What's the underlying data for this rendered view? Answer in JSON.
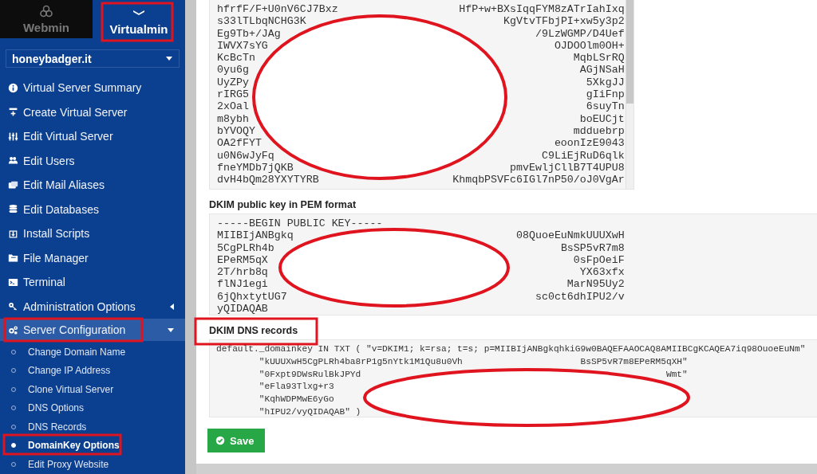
{
  "sidebar": {
    "tabs": [
      {
        "label": "Webmin",
        "selected": false
      },
      {
        "label": "Virtualmin",
        "selected": true
      }
    ],
    "domain_select": {
      "value": "honeybadger.it"
    },
    "menu": [
      {
        "kind": "link",
        "label": "Virtual Server Summary"
      },
      {
        "kind": "link",
        "label": "Create Virtual Server"
      },
      {
        "kind": "link",
        "label": "Edit Virtual Server"
      },
      {
        "kind": "link",
        "label": "Edit Users"
      },
      {
        "kind": "link",
        "label": "Edit Mail Aliases"
      },
      {
        "kind": "link",
        "label": "Edit Databases"
      },
      {
        "kind": "link",
        "label": "Install Scripts"
      },
      {
        "kind": "link",
        "label": "File Manager"
      },
      {
        "kind": "link",
        "label": "Terminal"
      },
      {
        "kind": "group",
        "label": "Administration Options",
        "expanded": false
      },
      {
        "kind": "group",
        "label": "Server Configuration",
        "expanded": true,
        "children": [
          {
            "label": "Change Domain Name",
            "selected": false
          },
          {
            "label": "Change IP Address",
            "selected": false
          },
          {
            "label": "Clone Virtual Server",
            "selected": false
          },
          {
            "label": "DNS Options",
            "selected": false
          },
          {
            "label": "DNS Records",
            "selected": false
          },
          {
            "label": "DomainKey Options",
            "selected": true
          },
          {
            "label": "Edit Proxy Website",
            "selected": false
          }
        ]
      }
    ]
  },
  "main": {
    "private_key": {
      "lines": [
        {
          "left": "hfrfF/F+U0nV6CJ7Bxz",
          "right": "HfP+w+BXsIqqFYM8zATrIahIxq"
        },
        {
          "left": "s33lTLbqNCHG3K",
          "right": "KgVtvTFbjPI+xw5y3p2"
        },
        {
          "left": "Eg9Tb+/JAg",
          "right": "/9LzWGMP/D4Uef"
        },
        {
          "left": "IWVX7sYG",
          "right": "OJDOOlm0OH+"
        },
        {
          "left": "KcBcTn",
          "right": "MqbLSrRQ"
        },
        {
          "left": "0yu6g",
          "right": "AGjNSaH"
        },
        {
          "left": "UyZPy",
          "right": "5XkgJJ"
        },
        {
          "left": "rIRG5",
          "right": "gIiFnp"
        },
        {
          "left": "2xOal",
          "right": "6suyTn"
        },
        {
          "left": "m8ybh",
          "right": "boEUCjt"
        },
        {
          "left": "bYVOQY",
          "right": "mdduebrp"
        },
        {
          "left": "OA2fFYT",
          "right": "eoonIzE9043"
        },
        {
          "left": "u0N6wJyFq",
          "right": "C9LiEjRuD6qlk"
        },
        {
          "left": "fneYMDb7jQKB",
          "right": "pmvEwljCllB7T4UPU8"
        },
        {
          "left": "dvH4bQm28YXYTYRB",
          "right": "KhmqbPSVFc6IGl7nP50/oJ0VgAr"
        }
      ]
    },
    "pem": {
      "title": "DKIM public key in PEM format",
      "lines": [
        {
          "left": "-----BEGIN PUBLIC KEY-----"
        },
        {
          "left": "MIIBIjANBgkq",
          "right": "08QuoeEuNmkUUUXwH"
        },
        {
          "left": "5CgPLRh4b",
          "right": "BsSP5vR7m8"
        },
        {
          "left": "EPeRM5qX",
          "right": "0sFpOeiF"
        },
        {
          "left": "2T/hrb8q",
          "right": "YX63xfx"
        },
        {
          "left": "flNJ1egi",
          "right": "MarN95Uy2"
        },
        {
          "left": "6jQhxtytUG7",
          "right": "sc0ct6dhIPU2/v"
        },
        {
          "left": "yQIDAQAB"
        }
      ]
    },
    "dns": {
      "title": "DKIM DNS records",
      "lines": [
        {
          "left": "default._domainkey IN TXT ( \"v=DKIM1; k=rsa; t=s; p=MIIBIjANBgkqhkiG9w0BAQEFAAOCAQ8AMIIBCgKCAQEA7iq98OuoeEuNm\""
        },
        {
          "left": "        \"kUUUXwH5CgPLRh4ba8rP1g5nYtk1M1Qu8u0Vh",
          "right": "BsSP5vR7m8EPeRM5qXH\""
        },
        {
          "left": "        \"0Fxpt9DWsRulBkJPYd",
          "right": "Wmt\""
        },
        {
          "left": "        \"eFla93Tlxg+r3"
        },
        {
          "left": "        \"KqhWDPMwE6yGo"
        },
        {
          "left": "        \"hIPU2/vyQIDAQAB\" )"
        }
      ]
    },
    "save_button": "Save"
  }
}
